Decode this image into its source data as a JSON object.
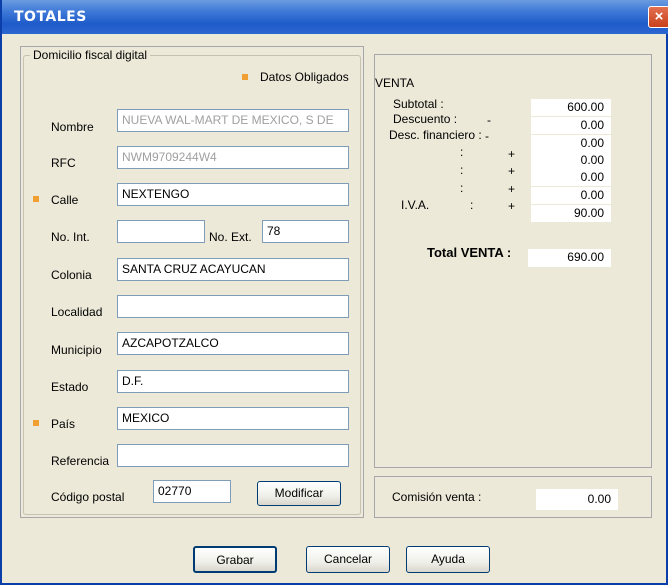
{
  "window": {
    "title": "TOTALES",
    "close_glyph": "×"
  },
  "form": {
    "legend": "Domicilio fiscal digital",
    "required_note": "Datos Obligados",
    "fields": {
      "nombre": {
        "label": "Nombre",
        "value": "NUEVA WAL-MART DE MEXICO, S DE"
      },
      "rfc": {
        "label": "RFC",
        "value": "NWM9709244W4"
      },
      "calle": {
        "label": "Calle",
        "value": "NEXTENGO"
      },
      "no_int": {
        "label": "No. Int.",
        "value": ""
      },
      "no_ext": {
        "label": "No. Ext.",
        "value": "78"
      },
      "colonia": {
        "label": "Colonia",
        "value": "SANTA CRUZ ACAYUCAN"
      },
      "localidad": {
        "label": "Localidad",
        "value": ""
      },
      "municipio": {
        "label": "Municipio",
        "value": "AZCAPOTZALCO"
      },
      "estado": {
        "label": "Estado",
        "value": "D.F."
      },
      "pais": {
        "label": "País",
        "value": "MEXICO"
      },
      "referencia": {
        "label": "Referencia",
        "value": ""
      },
      "codigo_postal": {
        "label": "Código postal",
        "value": "02770"
      }
    },
    "modify_button": "Modificar"
  },
  "venta": {
    "title": "VENTA",
    "rows": [
      {
        "label": "Subtotal :",
        "sign": "",
        "value": "600.00"
      },
      {
        "label": "Descuento :",
        "sign": "-",
        "value": "0.00"
      },
      {
        "label": "Desc. financiero :",
        "sign": "-",
        "value": "0.00"
      },
      {
        "label": ":",
        "sign": "+",
        "value": "0.00"
      },
      {
        "label": ":",
        "sign": "+",
        "value": "0.00"
      },
      {
        "label": ":",
        "sign": "+",
        "value": "0.00"
      },
      {
        "label": "I.V.A.",
        "colon": ":",
        "sign": "+",
        "value": "90.00"
      }
    ],
    "total_label": "Total VENTA :",
    "total_value": "690.00"
  },
  "comision": {
    "label": "Comisión venta :",
    "value": "0.00"
  },
  "buttons": {
    "grabar": "Grabar",
    "cancelar": "Cancelar",
    "ayuda": "Ayuda"
  },
  "colors": {
    "required_marker": "#f0a030",
    "title_bar": "#1f5bc9",
    "window_bg": "#ece9d8"
  }
}
